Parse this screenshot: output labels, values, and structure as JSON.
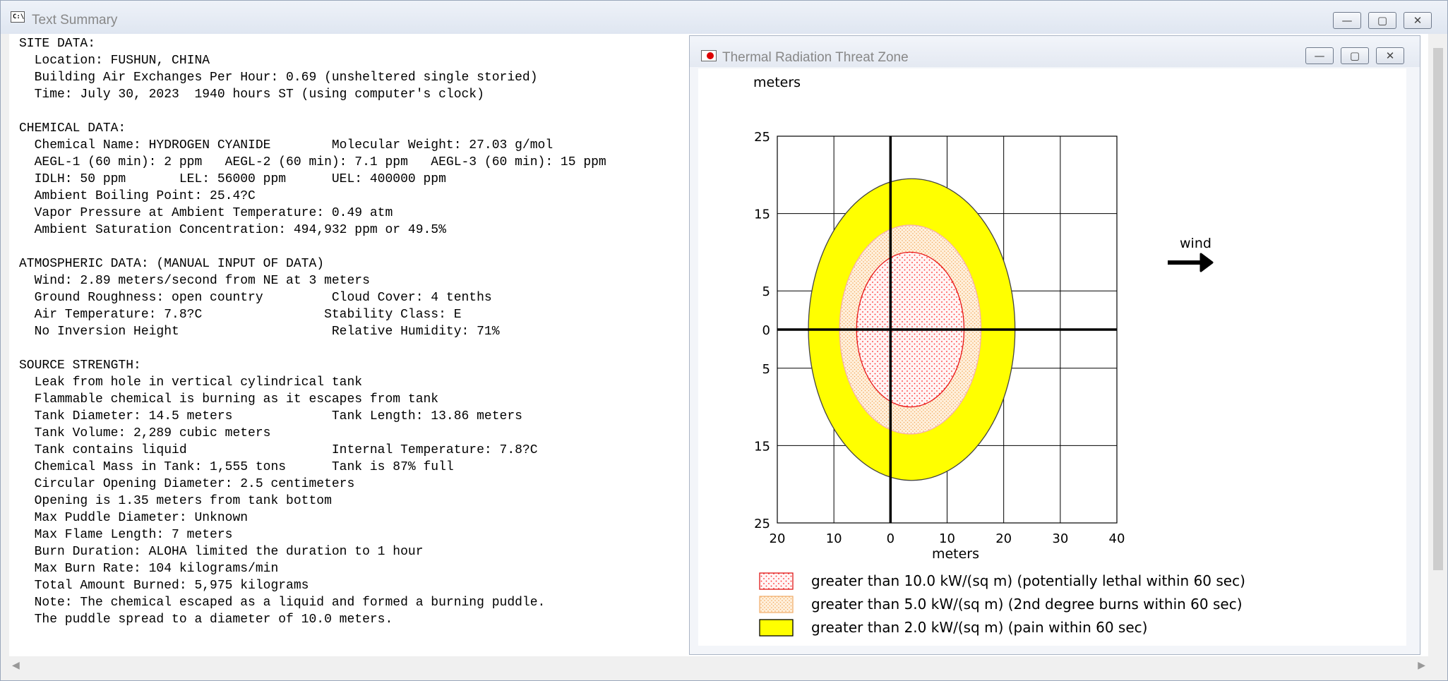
{
  "main_window": {
    "title": "Text Summary",
    "icon": "app-terminal-icon",
    "buttons": {
      "minimize": "—",
      "maximize": "▢",
      "close": "✕"
    }
  },
  "summary_lines": [
    "SITE DATA:",
    "  Location: FUSHUN, CHINA",
    "  Building Air Exchanges Per Hour: 0.69 (unsheltered single storied)",
    "  Time: July 30, 2023  1940 hours ST (using computer's clock)",
    "",
    "CHEMICAL DATA:",
    "  Chemical Name: HYDROGEN CYANIDE        Molecular Weight: 27.03 g/mol",
    "  AEGL-1 (60 min): 2 ppm   AEGL-2 (60 min): 7.1 ppm   AEGL-3 (60 min): 15 ppm",
    "  IDLH: 50 ppm       LEL: 56000 ppm      UEL: 400000 ppm",
    "  Ambient Boiling Point: 25.4?C",
    "  Vapor Pressure at Ambient Temperature: 0.49 atm",
    "  Ambient Saturation Concentration: 494,932 ppm or 49.5%",
    "",
    "ATMOSPHERIC DATA: (MANUAL INPUT OF DATA)",
    "  Wind: 2.89 meters/second from NE at 3 meters",
    "  Ground Roughness: open country         Cloud Cover: 4 tenths",
    "  Air Temperature: 7.8?C                Stability Class: E",
    "  No Inversion Height                    Relative Humidity: 71%",
    "",
    "SOURCE STRENGTH:",
    "  Leak from hole in vertical cylindrical tank",
    "  Flammable chemical is burning as it escapes from tank",
    "  Tank Diameter: 14.5 meters             Tank Length: 13.86 meters",
    "  Tank Volume: 2,289 cubic meters",
    "  Tank contains liquid                   Internal Temperature: 7.8?C",
    "  Chemical Mass in Tank: 1,555 tons      Tank is 87% full",
    "  Circular Opening Diameter: 2.5 centimeters",
    "  Opening is 1.35 meters from tank bottom",
    "  Max Puddle Diameter: Unknown",
    "  Max Flame Length: 7 meters",
    "  Burn Duration: ALOHA limited the duration to 1 hour",
    "  Max Burn Rate: 104 kilograms/min",
    "  Total Amount Burned: 5,975 kilograms",
    "  Note: The chemical escaped as a liquid and formed a burning puddle.",
    "  The puddle spread to a diameter of 10.0 meters."
  ],
  "child_window": {
    "title": "Thermal Radiation Threat Zone",
    "icon": "threat-zone-flame-icon",
    "buttons": {
      "minimize": "—",
      "maximize": "▢",
      "close": "✕"
    }
  },
  "chart_data": {
    "type": "threat-zone",
    "ylabel": "meters",
    "xlabel": "meters",
    "x_ticks": [
      "20",
      "10",
      "0",
      "10",
      "20",
      "30",
      "40"
    ],
    "x_tick_values": [
      -20,
      -10,
      0,
      10,
      20,
      30,
      40
    ],
    "y_ticks": [
      "25",
      "15",
      "5",
      "0",
      "5",
      "15",
      "25"
    ],
    "y_tick_values": [
      25,
      15,
      5,
      0,
      -5,
      -15,
      -25
    ],
    "xlim": [
      -20,
      40
    ],
    "ylim": [
      -25,
      25
    ],
    "grid": true,
    "wind_label": "wind",
    "zones": [
      {
        "label": "greater than 10.0 kW/(sq m) (potentially lethal within 60 sec)",
        "color": "#ff0000",
        "pattern": "red-dots",
        "x_min": -6,
        "x_max": 13,
        "y_min": -10,
        "y_max": 10
      },
      {
        "label": "greater than 5.0 kW/(sq m) (2nd degree burns within 60 sec)",
        "color": "#ffa500",
        "pattern": "orange-dots",
        "x_min": -9,
        "x_max": 16,
        "y_min": -13.5,
        "y_max": 13.5
      },
      {
        "label": "greater than 2.0 kW/(sq m) (pain within 60 sec)",
        "color": "#ffff00",
        "pattern": "solid",
        "x_min": -14.5,
        "x_max": 22,
        "y_min": -19.5,
        "y_max": 19.5
      }
    ]
  }
}
